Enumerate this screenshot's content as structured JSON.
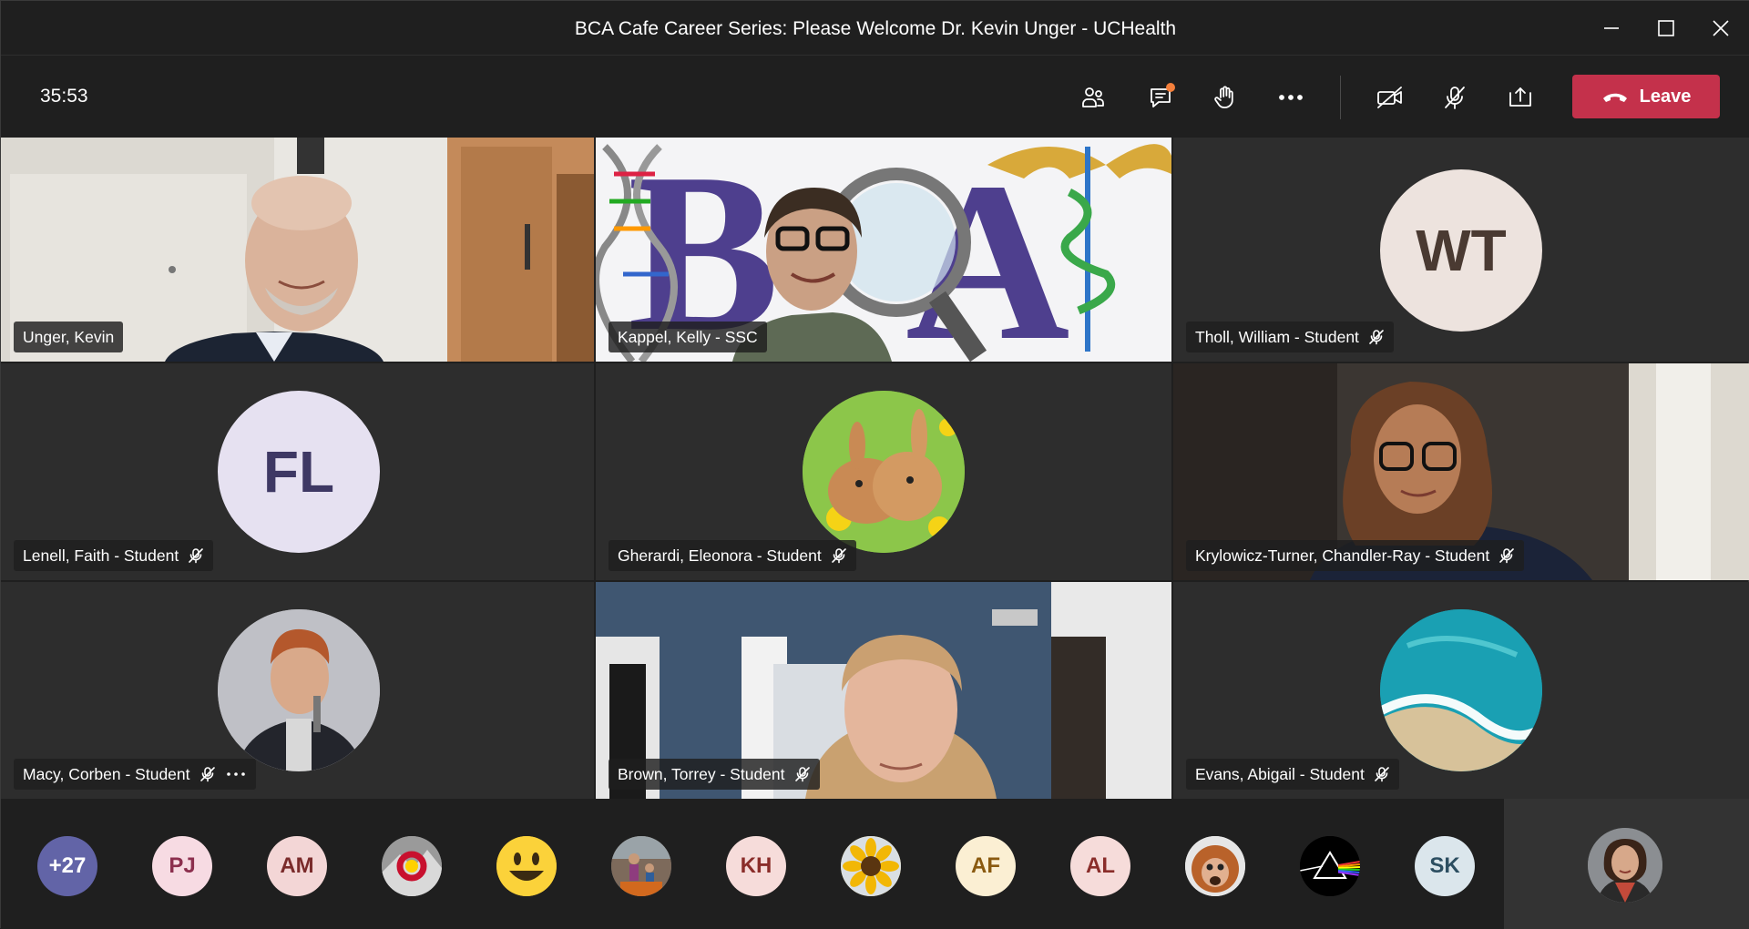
{
  "window": {
    "title": "BCA Cafe Career Series: Please Welcome Dr. Kevin Unger - UCHealth"
  },
  "toolbar": {
    "timer": "35:53",
    "icons": [
      "participants-icon",
      "chat-icon",
      "raise-hand-icon",
      "more-options-icon",
      "camera-off-icon",
      "mic-off-icon",
      "share-screen-icon"
    ],
    "leave_label": "Leave",
    "leave_color": "#c4314b"
  },
  "tiles": [
    {
      "name": "Unger, Kevin",
      "muted": false,
      "kind": "video"
    },
    {
      "name": "Kappel, Kelly - SSC",
      "muted": false,
      "kind": "video"
    },
    {
      "name": "Tholl, William - Student",
      "muted": true,
      "kind": "initials",
      "initials": "WT",
      "bg": "#ede3de",
      "fg": "#4a3a32"
    },
    {
      "name": "Lenell, Faith - Student",
      "muted": true,
      "kind": "initials",
      "initials": "FL",
      "bg": "#e6e1f1",
      "fg": "#3e3864"
    },
    {
      "name": "Gherardi, Eleonora - Student",
      "muted": true,
      "kind": "photo"
    },
    {
      "name": "Krylowicz-Turner, Chandler-Ray - Student",
      "muted": true,
      "kind": "video"
    },
    {
      "name": "Macy, Corben - Student",
      "muted": true,
      "kind": "photo",
      "more": true
    },
    {
      "name": "Brown, Torrey - Student",
      "muted": true,
      "kind": "video"
    },
    {
      "name": "Evans, Abigail - Student",
      "muted": true,
      "kind": "photo"
    }
  ],
  "roster": {
    "overflow": "+27",
    "overflow_bg": "#6264a7",
    "people": [
      {
        "initials": "PJ",
        "bg": "#f7dbe3",
        "fg": "#8c2f4e"
      },
      {
        "initials": "AM",
        "bg": "#f3d6d6",
        "fg": "#7a2b2b"
      },
      {
        "initials": "",
        "kind": "photo",
        "icon": "colorado-flag-icon"
      },
      {
        "initials": "",
        "kind": "photo",
        "icon": "smiley-icon"
      },
      {
        "initials": "",
        "kind": "photo",
        "icon": "family-photo-icon"
      },
      {
        "initials": "KH",
        "bg": "#f6dcda",
        "fg": "#8a2d2a"
      },
      {
        "initials": "",
        "kind": "photo",
        "icon": "sunflower-icon"
      },
      {
        "initials": "AF",
        "bg": "#fbefd3",
        "fg": "#8a5a10"
      },
      {
        "initials": "AL",
        "bg": "#f6dcda",
        "fg": "#8a2d2a"
      },
      {
        "initials": "",
        "kind": "photo",
        "icon": "orangutan-icon"
      },
      {
        "initials": "",
        "kind": "photo",
        "icon": "prism-icon"
      },
      {
        "initials": "SK",
        "bg": "#dbe6ec",
        "fg": "#2c4e61"
      }
    ]
  }
}
